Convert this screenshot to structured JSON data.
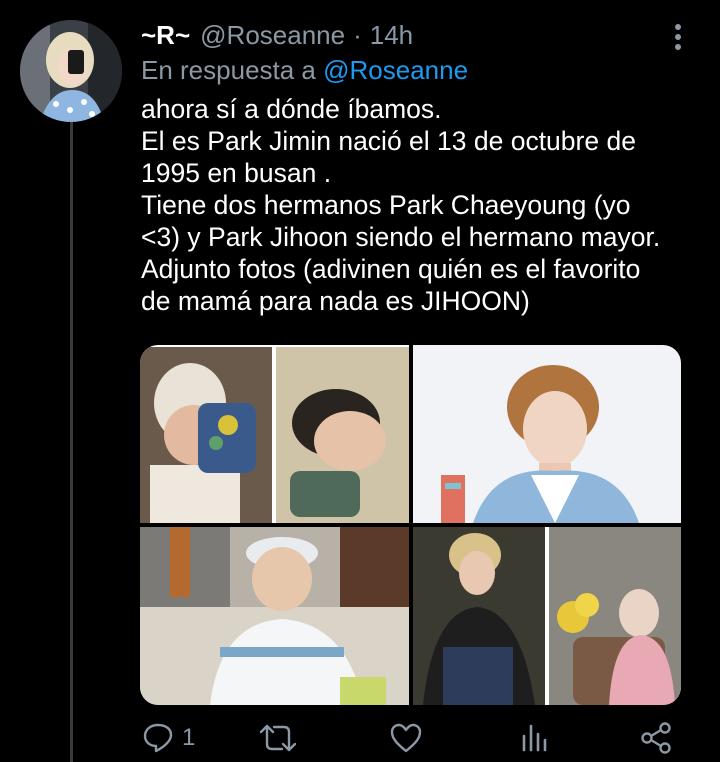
{
  "tweet": {
    "display_name": "~R~",
    "handle": "@Roseanne",
    "separator": "·",
    "time": "14h",
    "reply_prefix": "En respuesta a",
    "reply_to": "@Roseanne",
    "text_lines": [
      "ahora sí a dónde íbamos.",
      "El es Park Jimin nació el 13 de octubre de",
      "1995 en busan .",
      "Tiene dos hermanos Park Chaeyoung (yo",
      "<3) y Park Jihoon siendo el hermano mayor.",
      "Adjunto fotos (adivinen quién es el favorito",
      "de mamá para nada es JIHOON)"
    ]
  },
  "actions": {
    "reply_count": "1",
    "retweet_count": "",
    "like_count": ""
  },
  "icons": [
    "more-vertical-icon",
    "reply-icon",
    "retweet-icon",
    "like-icon",
    "analytics-icon",
    "share-icon"
  ],
  "colors": {
    "background": "#000000",
    "text": "#ffffff",
    "secondary": "#8b98a5",
    "link": "#1d9bf0",
    "thread_line": "#3a3a3a"
  }
}
